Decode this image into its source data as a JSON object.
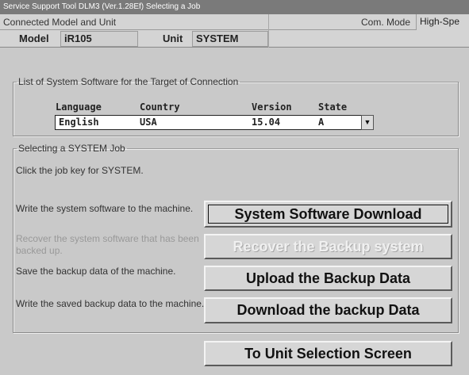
{
  "window": {
    "title": "Service Support Tool DLM3 (Ver.1.28Ef) Selecting a Job"
  },
  "connection": {
    "header_label": "Connected Model and Unit",
    "com_mode_label": "Com. Mode",
    "com_mode_value": "High-Spe",
    "model_label": "Model",
    "model_value": "iR105",
    "unit_label": "Unit",
    "unit_value": "SYSTEM"
  },
  "system_software": {
    "legend": "List of System Software for the Target of Connection",
    "headers": {
      "language": "Language",
      "country": "Country",
      "version": "Version",
      "state": "State"
    },
    "selected": {
      "language": "English",
      "country": "USA",
      "version": "15.04",
      "state": "A"
    },
    "dropdown_glyph": "▼"
  },
  "job_selection": {
    "legend": "Selecting a SYSTEM Job",
    "instruction": "Click the job key for SYSTEM.",
    "jobs": [
      {
        "description": "Write the system software to the machine.",
        "button": "System Software Download",
        "enabled": true
      },
      {
        "description": "Recover the system software that has been backed up.",
        "button": "Recover the Backup system",
        "enabled": false
      },
      {
        "description": "Save the backup data of the machine.",
        "button": "Upload the Backup Data",
        "enabled": true
      },
      {
        "description": "Write the saved backup data to the machine.",
        "button": "Download the backup Data",
        "enabled": true
      }
    ]
  },
  "navigation": {
    "unit_selection_button": "To Unit Selection Screen"
  }
}
